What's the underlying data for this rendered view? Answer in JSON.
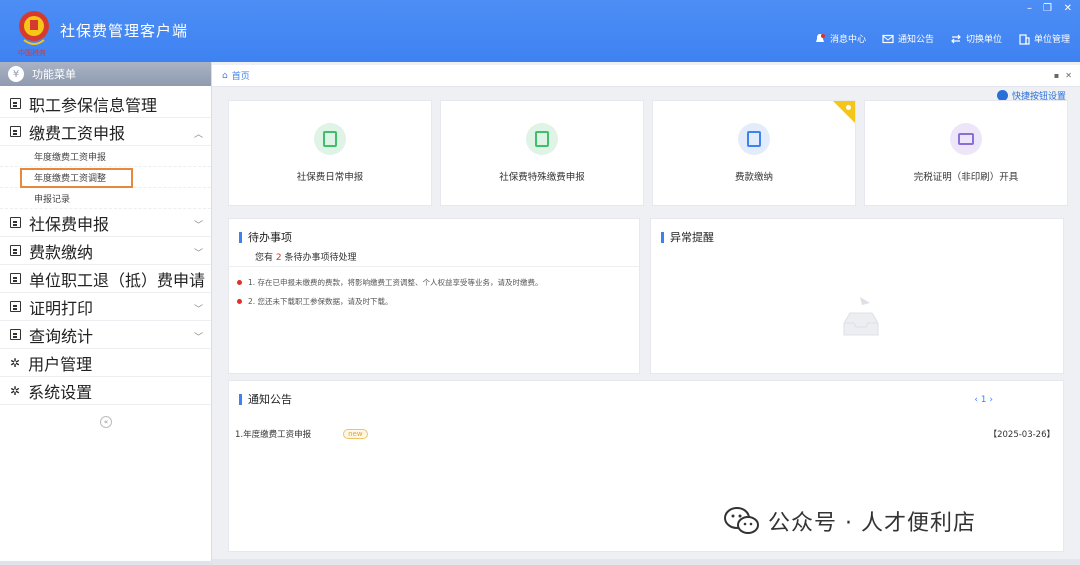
{
  "header": {
    "app_title": "社保费管理客户端",
    "logo_sub": "中国税务",
    "nav": [
      {
        "icon": "bell-icon",
        "label": "消息中心"
      },
      {
        "icon": "mail-icon",
        "label": "通知公告"
      },
      {
        "icon": "switch-icon",
        "label": "切换单位"
      },
      {
        "icon": "building-icon",
        "label": "单位管理"
      }
    ],
    "win_controls": [
      "–",
      "❐",
      "✕"
    ]
  },
  "sidebar": {
    "head": "功能菜单",
    "items": [
      {
        "label": "职工参保信息管理",
        "chevron": ""
      },
      {
        "label": "缴费工资申报",
        "chevron": "^"
      },
      {
        "label": "社保费申报",
        "chevron": "v"
      },
      {
        "label": "费款缴纳",
        "chevron": "v"
      },
      {
        "label": "单位职工退（抵）费申请",
        "chevron": ""
      },
      {
        "label": "证明打印",
        "chevron": "v"
      },
      {
        "label": "查询统计",
        "chevron": "v"
      },
      {
        "label": "用户管理",
        "chevron": ""
      },
      {
        "label": "系统设置",
        "chevron": ""
      }
    ],
    "sub_items": [
      "年度缴费工资申报",
      "年度缴费工资调整",
      "申报记录"
    ],
    "collapse": "«"
  },
  "content": {
    "breadcrumb": "首页",
    "bc_icons": [
      "▪",
      "✕"
    ],
    "quick_set": "快捷按钮设置",
    "cards": [
      {
        "label": "社保费日常申报",
        "icon": "clipboard-icon",
        "bg": "#dff3e6",
        "fg": "#3fbf6a"
      },
      {
        "label": "社保费特殊缴费申报",
        "icon": "clipboard-icon",
        "bg": "#dff3e6",
        "fg": "#3fbf6a"
      },
      {
        "label": "费款缴纳",
        "icon": "book-icon",
        "bg": "#e3ecfb",
        "fg": "#3e82f2"
      },
      {
        "label": "完税证明（非印刷）开具",
        "icon": "printer-icon",
        "bg": "#ece6f8",
        "fg": "#8a6fd6"
      }
    ],
    "todo": {
      "title": "待办事项",
      "sub_pre": "您有",
      "count": "2",
      "sub_post": "条待办事项待处理",
      "items": [
        "1. 存在已申报未缴费的费款，将影响缴费工资调整、个人权益享受等业务，请及时缴费。",
        "2. 您还未下载职工参保数据，请及时下载。"
      ]
    },
    "alert": {
      "title": "异常提醒"
    },
    "notice": {
      "title": "通知公告",
      "pager": "‹  1  ›",
      "rows": [
        {
          "title": "1.年度缴费工资申报",
          "badge": "new",
          "date": "【2025-03-26】"
        }
      ]
    }
  },
  "watermark": "公众号 · 人才便利店"
}
